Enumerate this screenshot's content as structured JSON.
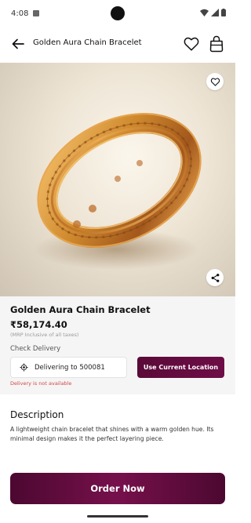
{
  "status_bar": {
    "time": "4:08"
  },
  "app_bar": {
    "title": "Golden Aura Chain Bracelet"
  },
  "product": {
    "name": "Golden Aura Chain Bracelet",
    "price": "₹58,174.40",
    "mrp_note": "(MRP Inclusive of all taxes)"
  },
  "delivery": {
    "check_label": "Check Delivery",
    "pincode_text": "Delivering to 500081",
    "use_location_label": "Use Current Location",
    "error": "Delivery is not available"
  },
  "description": {
    "title": "Description",
    "text": "A lightweight chain bracelet that shines with a warm golden hue. Its minimal design makes it the perfect layering piece."
  },
  "order_button": {
    "label": "Order Now"
  },
  "colors": {
    "accent": "#6e0d47",
    "error": "#d64545",
    "gold": "#c8802a"
  }
}
